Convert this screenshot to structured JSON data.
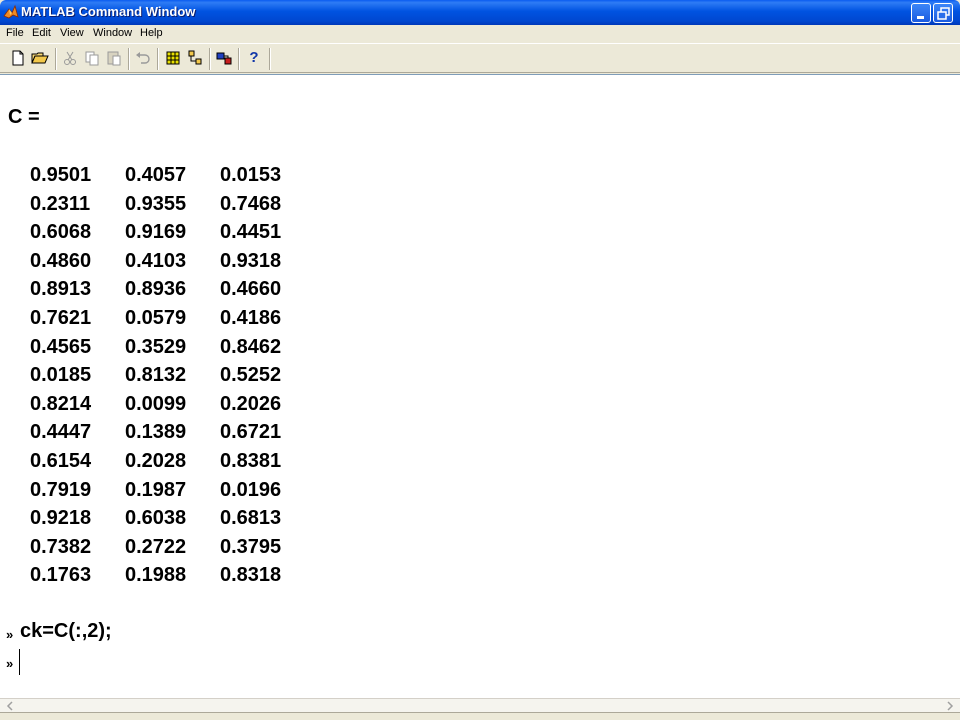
{
  "window": {
    "title": "MATLAB Command Window"
  },
  "menu": [
    {
      "label": "File"
    },
    {
      "label": "Edit"
    },
    {
      "label": "View"
    },
    {
      "label": "Window"
    },
    {
      "label": "Help"
    }
  ],
  "toolbar": {
    "buttons": [
      "new-file-icon",
      "open-folder-icon",
      "cut-icon",
      "copy-icon",
      "paste-icon",
      "undo-icon",
      "workspace-icon",
      "path-browser-icon",
      "simulink-icon",
      "help-icon"
    ],
    "help_label": "?"
  },
  "output": {
    "variable_line": "C =",
    "matrix": [
      [
        "0.9501",
        "0.4057",
        "0.0153"
      ],
      [
        "0.2311",
        "0.9355",
        "0.7468"
      ],
      [
        "0.6068",
        "0.9169",
        "0.4451"
      ],
      [
        "0.4860",
        "0.4103",
        "0.9318"
      ],
      [
        "0.8913",
        "0.8936",
        "0.4660"
      ],
      [
        "0.7621",
        "0.0579",
        "0.4186"
      ],
      [
        "0.4565",
        "0.3529",
        "0.8462"
      ],
      [
        "0.0185",
        "0.8132",
        "0.5252"
      ],
      [
        "0.8214",
        "0.0099",
        "0.2026"
      ],
      [
        "0.4447",
        "0.1389",
        "0.6721"
      ],
      [
        "0.6154",
        "0.2028",
        "0.8381"
      ],
      [
        "0.7919",
        "0.1987",
        "0.0196"
      ],
      [
        "0.9218",
        "0.6038",
        "0.6813"
      ],
      [
        "0.7382",
        "0.2722",
        "0.3795"
      ],
      [
        "0.1763",
        "0.1988",
        "0.8318"
      ]
    ],
    "prompt_symbol": "»",
    "last_command": "ck=C(:,2);",
    "current_input": ""
  },
  "colors": {
    "titlebar": "#0053E1",
    "background": "#FFFFFF",
    "chrome": "#ECE9D8"
  }
}
